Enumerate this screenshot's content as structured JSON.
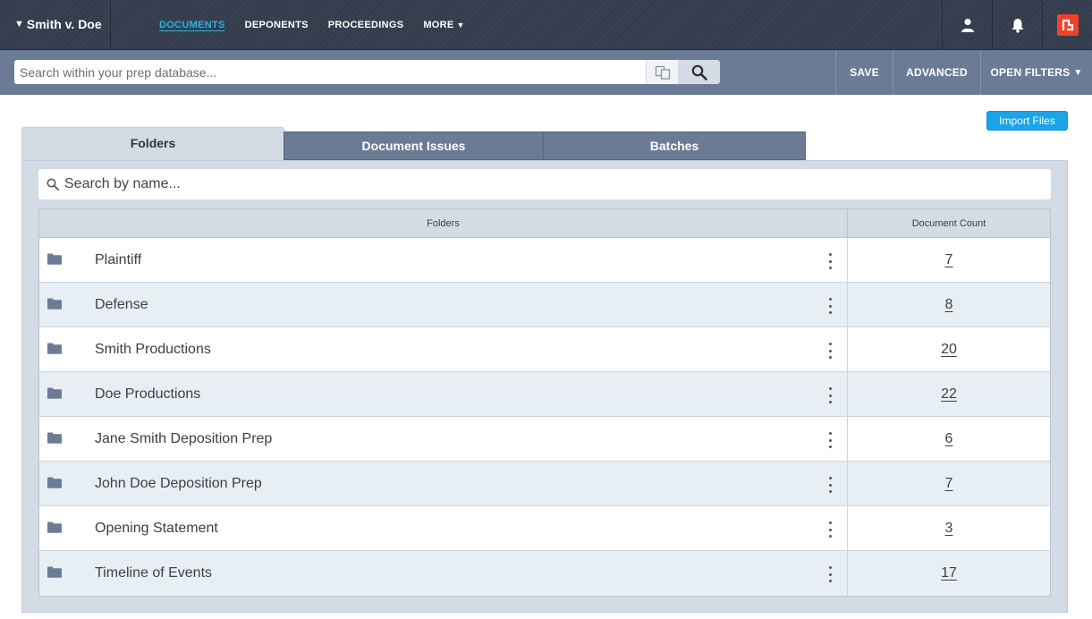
{
  "nav": {
    "case_title": "Smith v. Doe",
    "links": [
      {
        "label": "DOCUMENTS",
        "active": true
      },
      {
        "label": "DEPONENTS",
        "active": false
      },
      {
        "label": "PROCEEDINGS",
        "active": false
      },
      {
        "label": "MORE",
        "active": false
      }
    ],
    "icons": [
      "user-icon",
      "bell-icon",
      "app-logo-icon"
    ],
    "accent_color": "#27b3e6",
    "logo_color": "#f0412b"
  },
  "search": {
    "placeholder": "Search within your prep database...",
    "value": ""
  },
  "actions": {
    "save": "SAVE",
    "advanced": "ADVANCED",
    "open_filters": "OPEN FILTERS"
  },
  "import_button": "Import Files",
  "tabs": {
    "folders": "Folders",
    "document_issues": "Document Issues",
    "batches": "Batches"
  },
  "folder_search": {
    "placeholder": "Search by name...",
    "value": ""
  },
  "table": {
    "header_name": "Folders",
    "header_count": "Document Count",
    "rows": [
      {
        "name": "Plaintiff",
        "count": "7"
      },
      {
        "name": "Defense",
        "count": "8"
      },
      {
        "name": "Smith Productions",
        "count": "20"
      },
      {
        "name": "Doe Productions",
        "count": "22"
      },
      {
        "name": "Jane Smith Deposition Prep",
        "count": "6"
      },
      {
        "name": "John Doe Deposition Prep",
        "count": "7"
      },
      {
        "name": "Opening Statement",
        "count": "3"
      },
      {
        "name": "Timeline of Events",
        "count": "17"
      }
    ]
  }
}
